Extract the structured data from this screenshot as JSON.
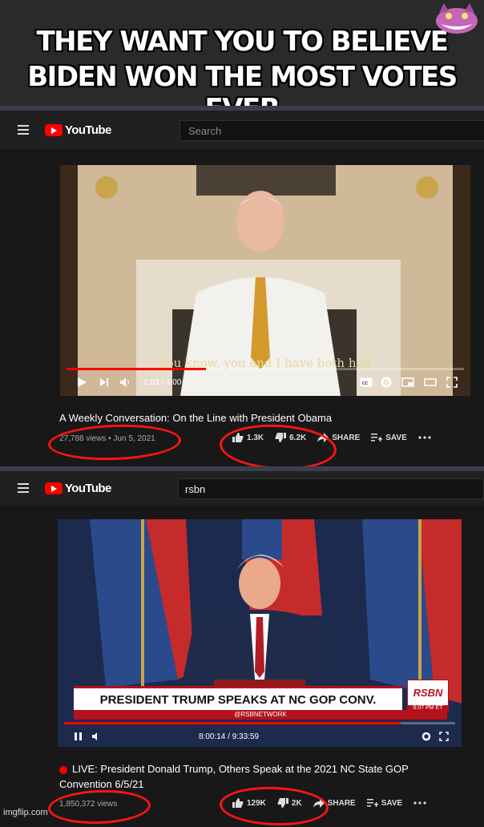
{
  "meme": {
    "caption_line1": "THEY WANT YOU TO BELIEVE",
    "caption_line2": "BIDEN WON THE MOST VOTES EVER",
    "watermark": "imgflip.com"
  },
  "colors": {
    "accent_red": "#ff0000",
    "annotation_red": "#ff1414",
    "background": "#181818",
    "topbar": "#202020"
  },
  "top_panel": {
    "logo_text": "YouTube",
    "search_placeholder": "Search",
    "video": {
      "subtitle": "You know, you and I have both had",
      "time": "1:03 / 3:00",
      "progress": 0.35
    },
    "title": "A Weekly Conversation: On the Line with President Obama",
    "meta": "27,788 views • Jun 5, 2021",
    "likes": "1.3K",
    "dislikes": "6.2K",
    "share_label": "SHARE",
    "save_label": "SAVE",
    "more_icon": "more-horiz-icon"
  },
  "bottom_panel": {
    "logo_text": "YouTube",
    "search_value": "rsbn",
    "video": {
      "banner": "PRESIDENT TRUMP SPEAKS AT NC GOP CONV.",
      "network": "RSBN",
      "network_time": "6:07 PM ET",
      "ticker": "@RSBNETWORK",
      "time": "8:00:14 / 9:33:59",
      "progress": 0.86
    },
    "title": "LIVE: President Donald Trump, Others Speak at the 2021 NC State GOP Convention 6/5/21",
    "meta": "1,850,372 views",
    "likes": "129K",
    "dislikes": "2K",
    "share_label": "SHARE",
    "save_label": "SAVE",
    "more_icon": "more-horiz-icon"
  }
}
